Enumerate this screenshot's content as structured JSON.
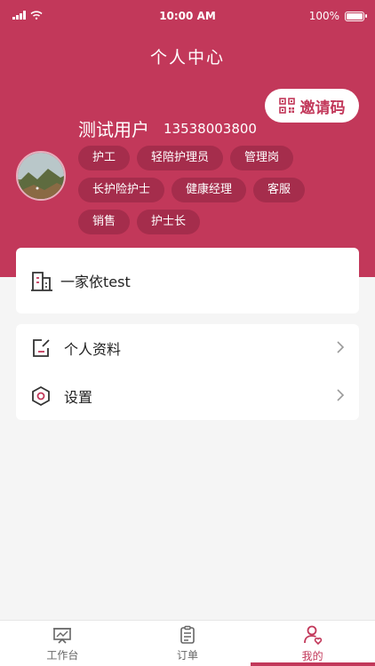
{
  "status_bar": {
    "time": "10:00 AM",
    "battery": "100%"
  },
  "header": {
    "title": "个人中心",
    "invite_label": "邀请码"
  },
  "profile": {
    "name": "测试用户",
    "phone": "13538003800",
    "tags": [
      "护工",
      "轻陪护理员",
      "管理岗",
      "长护险护士",
      "健康经理",
      "客服",
      "销售",
      "护士长"
    ]
  },
  "organization": {
    "name": "一家依test"
  },
  "menu": {
    "items": [
      {
        "label": "个人资料"
      },
      {
        "label": "设置"
      }
    ]
  },
  "tabbar": {
    "items": [
      {
        "label": "工作台"
      },
      {
        "label": "订单"
      },
      {
        "label": "我的"
      }
    ],
    "active": "我的"
  },
  "colors": {
    "brand": "#c2385a",
    "tag_bg": "#a52d4c"
  }
}
